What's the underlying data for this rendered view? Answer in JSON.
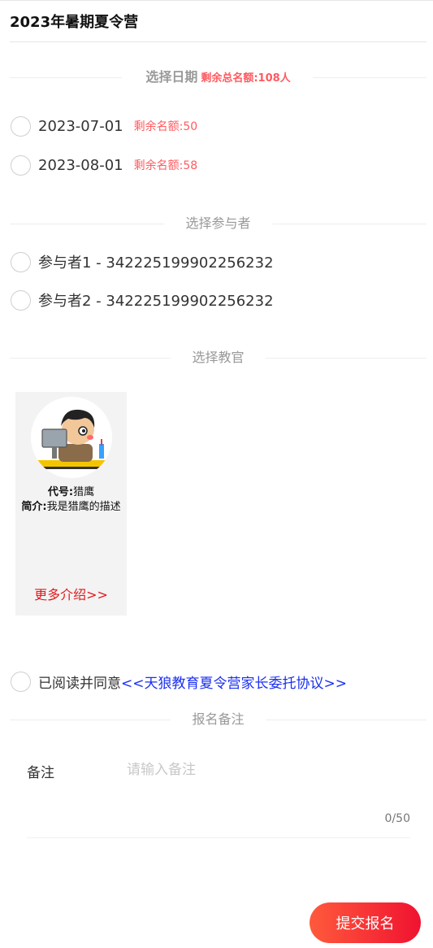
{
  "header": {
    "title": "2023年暑期夏令营"
  },
  "date_section": {
    "title": "选择日期",
    "total_quota": "剩余总名额:108人",
    "options": [
      {
        "date": "2023-07-01",
        "quota": "剩余名额:50"
      },
      {
        "date": "2023-08-01",
        "quota": "剩余名额:58"
      }
    ]
  },
  "participant_section": {
    "title": "选择参与者",
    "options": [
      {
        "label": "参与者1 - 342225199902256232"
      },
      {
        "label": "参与者2 - 342225199902256232"
      }
    ]
  },
  "instructor_section": {
    "title": "选择教官",
    "card": {
      "code_label": "代号:",
      "code_value": "猎鹰",
      "intro_label": "简介:",
      "intro_value": "我是猎鹰的描述",
      "more_link": "更多介绍>>"
    }
  },
  "agreement": {
    "prefix": "已阅读并同意",
    "link": "<<天狼教育夏令营家长委托协议>>"
  },
  "remark_section": {
    "title": "报名备注",
    "label": "备注",
    "placeholder": "请输入备注",
    "counter": "0/50"
  },
  "submit": {
    "label": "提交报名"
  },
  "colors": {
    "accent_red": "#ff5a5f",
    "link_blue": "#1a2ff0",
    "button_gradient_start": "#ff5a3c",
    "button_gradient_end": "#f01230"
  }
}
